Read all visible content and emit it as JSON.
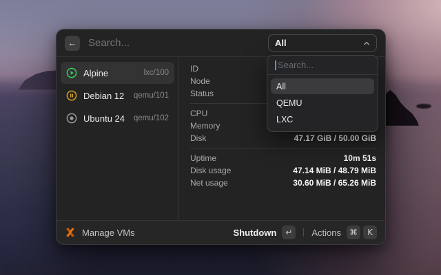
{
  "header": {
    "search_placeholder": "Search...",
    "filter_dropdown": {
      "selected": "All"
    }
  },
  "vm_list": [
    {
      "title": "Alpine",
      "accessory": "lxc/100",
      "status": "running",
      "selected": true
    },
    {
      "title": "Debian 12",
      "accessory": "qemu/101",
      "status": "paused",
      "selected": false
    },
    {
      "title": "Ubuntu 24",
      "accessory": "qemu/102",
      "status": "stopped",
      "selected": false
    }
  ],
  "details": {
    "groups": [
      {
        "rows": [
          {
            "label": "ID",
            "value": ""
          },
          {
            "label": "Node",
            "value": ""
          },
          {
            "label": "Status",
            "value": ""
          }
        ]
      },
      {
        "rows": [
          {
            "label": "CPU",
            "value": ""
          },
          {
            "label": "Memory",
            "value": ""
          },
          {
            "label": "Disk",
            "value": "47.17 GiB / 50.00 GiB"
          }
        ]
      },
      {
        "rows": [
          {
            "label": "Uptime",
            "value": "10m 51s"
          },
          {
            "label": "Disk usage",
            "value": "47.14 MiB / 48.79 MiB"
          },
          {
            "label": "Net usage",
            "value": "30.60 MiB / 65.26 MiB"
          }
        ]
      }
    ]
  },
  "filter_popover": {
    "search_placeholder": "Search...",
    "options": [
      {
        "label": "All",
        "highlighted": true
      },
      {
        "label": "QEMU",
        "highlighted": false
      },
      {
        "label": "LXC",
        "highlighted": false
      }
    ]
  },
  "footer": {
    "app_label": "Manage VMs",
    "primary_action": "Shutdown",
    "primary_key": "↵",
    "secondary_action": "Actions",
    "secondary_keys": [
      "⌘",
      "K"
    ]
  },
  "icons": {
    "back": "arrow-left-icon",
    "trigger_chevron": "chevron-up-icon",
    "running": "play-circle-icon",
    "paused": "pause-circle-icon",
    "stopped": "stop-circle-icon",
    "app": "proxmox-icon"
  },
  "colors": {
    "status_running": "#31d15d",
    "status_paused": "#d9a028",
    "status_stopped": "#98989d",
    "caret_accent": "#3f9bff",
    "proxmox_orange": "#e8720c",
    "window_bg": "#232324"
  }
}
